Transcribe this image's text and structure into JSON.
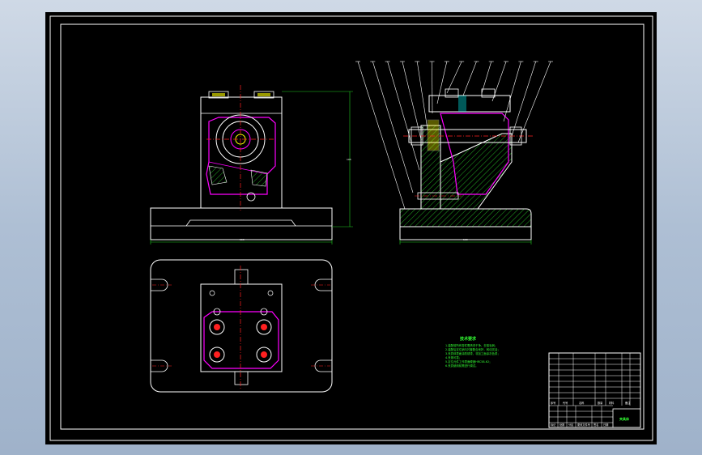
{
  "drawing": {
    "colors": {
      "background_outer": "#aebfd4",
      "sheet": "#000000",
      "border": "#ffffff",
      "outline": "#ffffff",
      "magenta": "#ff00ff",
      "centerline": "#ff2020",
      "dimension": "#22cc22",
      "hatch": "#22aa22",
      "notes": "#33ff33",
      "accent_yellow": "#ffff00",
      "accent_cyan": "#00ffff"
    },
    "views": [
      "front-view",
      "side-section-view",
      "top-view"
    ],
    "balloon_count": 14,
    "dimensions": {
      "front_height_label": "105",
      "front_width_label": "160",
      "side_width_label": "160"
    },
    "notes": {
      "title": "技术要求",
      "lines": [
        "1.装配前所有零件需清洗干净，去除毛刺；",
        "2.装配后定位销与衬套配合良好，转动灵活；",
        "3.夹具体表面涂防锈漆，非加工面涂灰色漆；",
        "4.夹紧可靠；",
        "5.定位元件工作表面硬度HRC58-62；",
        "6.夹具使用前需进行调试。"
      ]
    },
    "title_block": {
      "drawing_name": "夹具体",
      "material_code": "",
      "cells_top": [
        "序号",
        "代号",
        "名称",
        "数量",
        "材料",
        "备注"
      ],
      "cells_bottom": [
        "标记",
        "处数",
        "分区",
        "更改文件号",
        "签名",
        "日期"
      ]
    }
  }
}
